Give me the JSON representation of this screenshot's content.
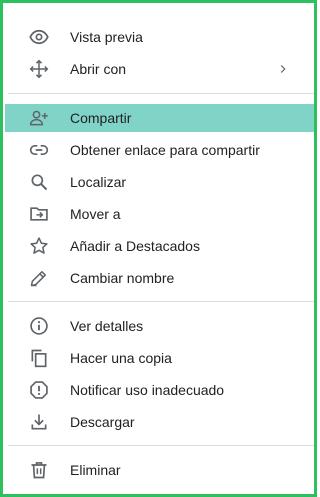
{
  "menu": {
    "items": [
      {
        "label": "Vista previa",
        "icon": "eye-icon"
      },
      {
        "label": "Abrir con",
        "icon": "move-arrows-icon",
        "submenu_indicator": "chevron-right-icon"
      },
      {
        "label": "Compartir",
        "icon": "person-add-icon",
        "highlighted": true
      },
      {
        "label": "Obtener enlace para compartir",
        "icon": "link-icon"
      },
      {
        "label": "Localizar",
        "icon": "search-icon"
      },
      {
        "label": "Mover a",
        "icon": "folder-move-icon"
      },
      {
        "label": "Añadir a Destacados",
        "icon": "star-outline-icon"
      },
      {
        "label": "Cambiar nombre",
        "icon": "pencil-icon"
      },
      {
        "label": "Ver detalles",
        "icon": "info-icon"
      },
      {
        "label": "Hacer una copia",
        "icon": "copy-icon"
      },
      {
        "label": "Notificar uso inadecuado",
        "icon": "report-icon"
      },
      {
        "label": "Descargar",
        "icon": "download-icon"
      },
      {
        "label": "Eliminar",
        "icon": "trash-icon"
      }
    ]
  },
  "colors": {
    "frame_border": "#2ec05f",
    "highlight": "#80d4c7",
    "text": "#202124",
    "icon": "#5f6368",
    "divider": "#dadce0"
  }
}
